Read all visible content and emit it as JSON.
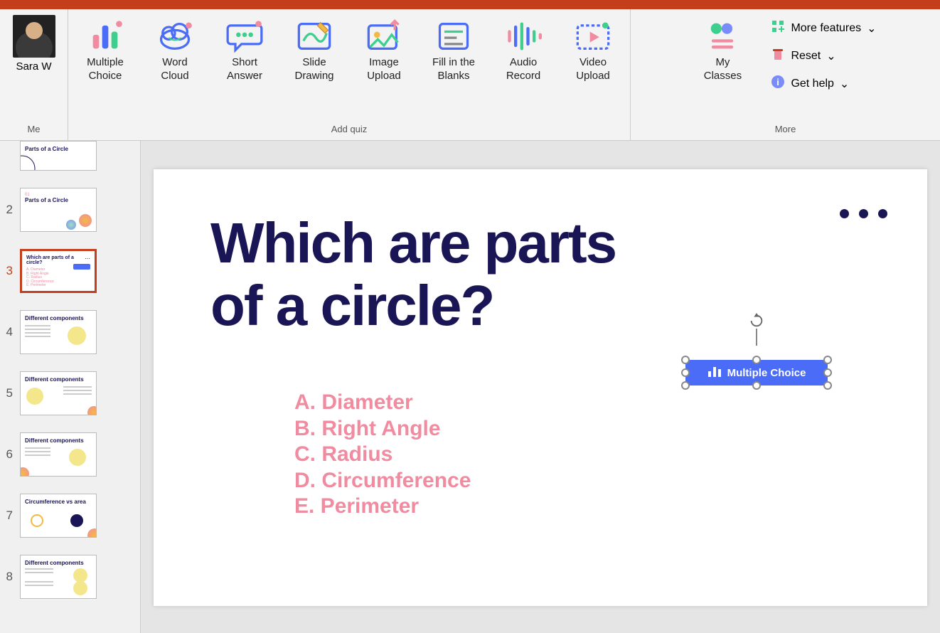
{
  "user": {
    "name": "Sara W"
  },
  "ribbon": {
    "groups": {
      "me": "Me",
      "quiz": "Add quiz",
      "more": "More"
    },
    "buttons": [
      {
        "label": "Multiple Choice"
      },
      {
        "label": "Word Cloud"
      },
      {
        "label": "Short Answer"
      },
      {
        "label": "Slide Drawing"
      },
      {
        "label": "Image Upload"
      },
      {
        "label": "Fill in the Blanks"
      },
      {
        "label": "Audio Record"
      },
      {
        "label": "Video Upload"
      }
    ],
    "myclasses": "My Classes",
    "more_items": [
      "More features",
      "Reset",
      "Get help"
    ]
  },
  "thumbs": {
    "numbers": [
      "",
      "2",
      "3",
      "4",
      "5",
      "6",
      "7",
      "8"
    ],
    "selected": 3,
    "titles": [
      "Parts of a Circle",
      "Parts of a Circle",
      "Which are parts of a circle?",
      "Different components",
      "Different components",
      "Different components",
      "Circumference vs area",
      "Different components"
    ]
  },
  "slide": {
    "title_line1": "Which are parts",
    "title_line2": "of a circle?",
    "options": [
      "A. Diameter",
      "B. Right Angle",
      "C. Radius",
      "D. Circumference",
      "E. Perimeter"
    ],
    "badge": "Multiple Choice"
  }
}
